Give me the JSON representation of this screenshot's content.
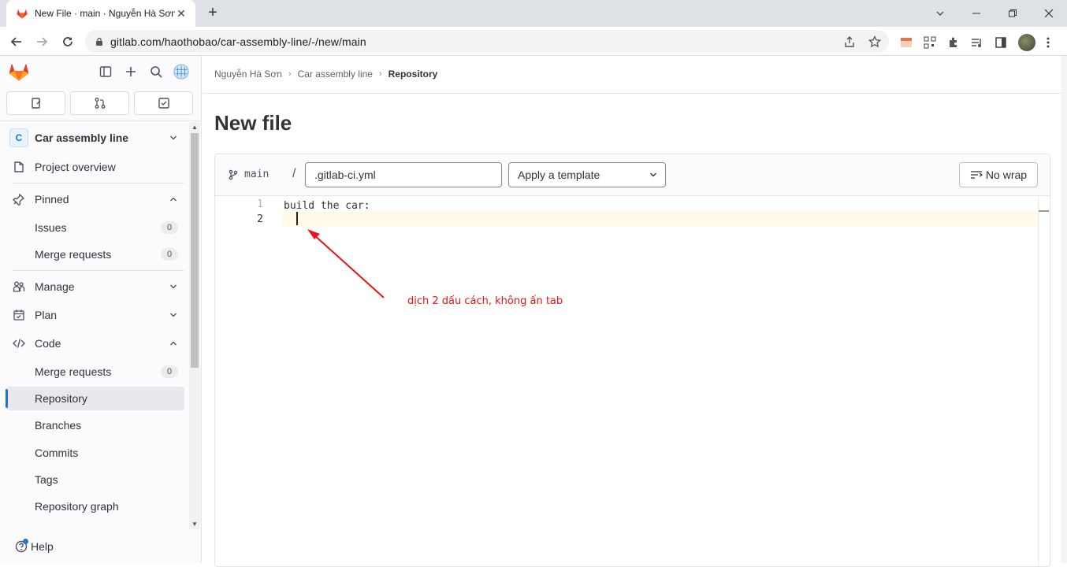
{
  "browser": {
    "tab_title": "New File · main · Nguyễn Hà Sơn",
    "url": "gitlab.com/haothobao/car-assembly-line/-/new/main"
  },
  "sidebar": {
    "project_initial": "C",
    "project_name": "Car assembly line",
    "items": {
      "project_overview": "Project overview",
      "pinned": "Pinned",
      "issues": "Issues",
      "issues_count": "0",
      "merge_requests_pinned": "Merge requests",
      "merge_requests_pinned_count": "0",
      "manage": "Manage",
      "plan": "Plan",
      "code": "Code",
      "merge_requests": "Merge requests",
      "merge_requests_count": "0",
      "repository": "Repository",
      "branches": "Branches",
      "commits": "Commits",
      "tags": "Tags",
      "repository_graph": "Repository graph"
    },
    "help": "Help"
  },
  "breadcrumb": [
    "Nguyễn Hà Sơn",
    "Car assembly line",
    "Repository"
  ],
  "page_title": "New file",
  "editor": {
    "branch": "main",
    "path_separator": "/",
    "filename": ".gitlab-ci.yml",
    "template_label": "Apply a template",
    "wrap_label": "No wrap",
    "line_numbers": [
      "1",
      "2"
    ],
    "code_line_1": "build the car:",
    "code_line_2": ""
  },
  "annotation": {
    "text": "dịch 2 dấu cách, không ấn tab",
    "color": "#e8131b"
  },
  "colors": {
    "accent": "#1f75cb",
    "gitlab_orange": "#e24329"
  }
}
